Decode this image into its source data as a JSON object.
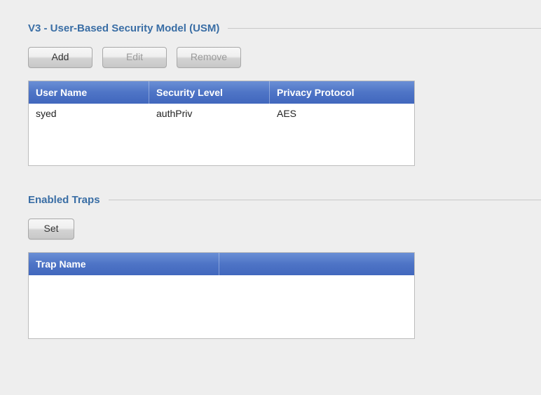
{
  "usm": {
    "title": "V3 - User-Based Security Model (USM)",
    "buttons": {
      "add": "Add",
      "edit": "Edit",
      "remove": "Remove"
    },
    "columns": {
      "user": "User Name",
      "level": "Security Level",
      "priv": "Privacy Protocol"
    },
    "rows": [
      {
        "user": "syed",
        "level": "authPriv",
        "priv": "AES"
      }
    ]
  },
  "traps": {
    "title": "Enabled Traps",
    "buttons": {
      "set": "Set"
    },
    "columns": {
      "name": "Trap Name",
      "blank": ""
    },
    "rows": []
  }
}
